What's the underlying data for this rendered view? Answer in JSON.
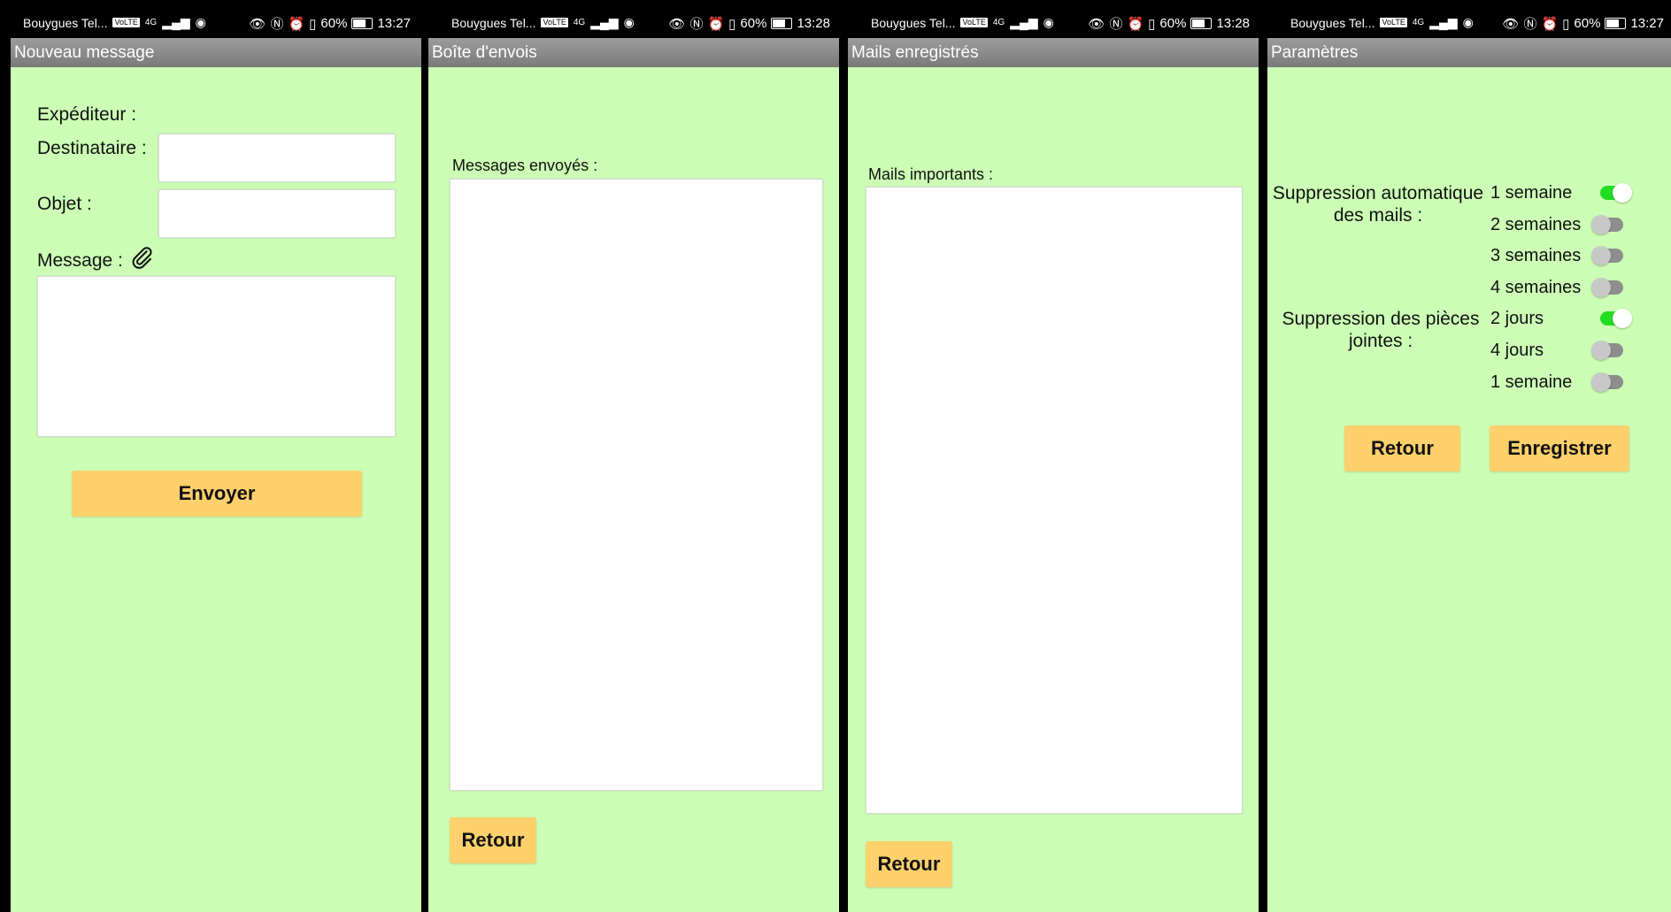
{
  "status": {
    "carrier": "Bouygues Tel...",
    "volte": "VoLTE",
    "network": "4G",
    "battery": "60%",
    "screens_time": [
      "13:27",
      "13:28",
      "13:28",
      "13:27"
    ]
  },
  "new_message": {
    "title": "Nouveau message",
    "sender_label": "Expéditeur :",
    "recipient_label": "Destinataire :",
    "subject_label": "Objet :",
    "message_label": "Message :",
    "attach_icon": "paperclip-icon",
    "send_label": "Envoyer"
  },
  "outbox": {
    "title": "Boîte d'envois",
    "list_label": "Messages envoyés :",
    "back_label": "Retour"
  },
  "saved": {
    "title": "Mails enregistrés",
    "list_label": "Mails importants :",
    "back_label": "Retour"
  },
  "settings": {
    "title": "Paramètres",
    "auto_delete_label": "Suppression automatique des mails :",
    "auto_delete_options": [
      {
        "label": "1 semaine",
        "on": true
      },
      {
        "label": "2 semaines",
        "on": false
      },
      {
        "label": "3 semaines",
        "on": false
      },
      {
        "label": "4 semaines",
        "on": false
      }
    ],
    "attach_delete_label": "Suppression des pièces jointes :",
    "attach_delete_options": [
      {
        "label": "2 jours",
        "on": true
      },
      {
        "label": "4 jours",
        "on": false
      },
      {
        "label": "1 semaine",
        "on": false
      }
    ],
    "back_label": "Retour",
    "save_label": "Enregistrer"
  },
  "colors": {
    "background": "#ccffb5",
    "button": "#ffd06b",
    "toggle_on": "#22dd22",
    "toggle_off": "#8e8e8e"
  }
}
